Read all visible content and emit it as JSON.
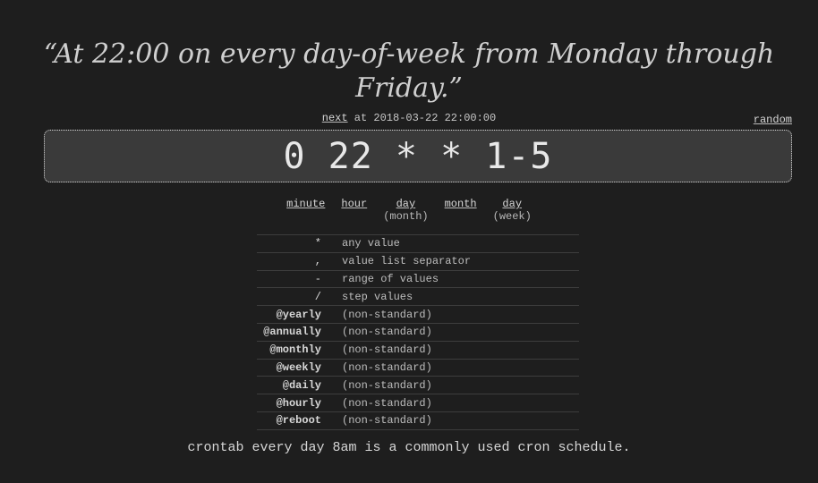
{
  "description": "“At 22:00 on every day-of-week from Monday through Friday.”",
  "next": {
    "label": "next",
    "text": "at 2018-03-22 22:00:00"
  },
  "random_label": "random",
  "cron_expression": "0 22 * * 1-5",
  "parts": [
    {
      "label": "minute",
      "sub": ""
    },
    {
      "label": "hour",
      "sub": ""
    },
    {
      "label": "day",
      "sub": "(month)"
    },
    {
      "label": "month",
      "sub": ""
    },
    {
      "label": "day",
      "sub": "(week)"
    }
  ],
  "legend": [
    {
      "symbol": "*",
      "desc": "any value"
    },
    {
      "symbol": ",",
      "desc": "value list separator"
    },
    {
      "symbol": "-",
      "desc": "range of values"
    },
    {
      "symbol": "/",
      "desc": "step values"
    },
    {
      "symbol": "@yearly",
      "desc": "(non-standard)"
    },
    {
      "symbol": "@annually",
      "desc": "(non-standard)"
    },
    {
      "symbol": "@monthly",
      "desc": "(non-standard)"
    },
    {
      "symbol": "@weekly",
      "desc": "(non-standard)"
    },
    {
      "symbol": "@daily",
      "desc": "(non-standard)"
    },
    {
      "symbol": "@hourly",
      "desc": "(non-standard)"
    },
    {
      "symbol": "@reboot",
      "desc": "(non-standard)"
    }
  ],
  "footer": "crontab every day 8am is a commonly used cron schedule.",
  "colors": {
    "background": "#1e1e1e",
    "input_background": "#3a3a3a",
    "text": "#d0d0d0"
  }
}
